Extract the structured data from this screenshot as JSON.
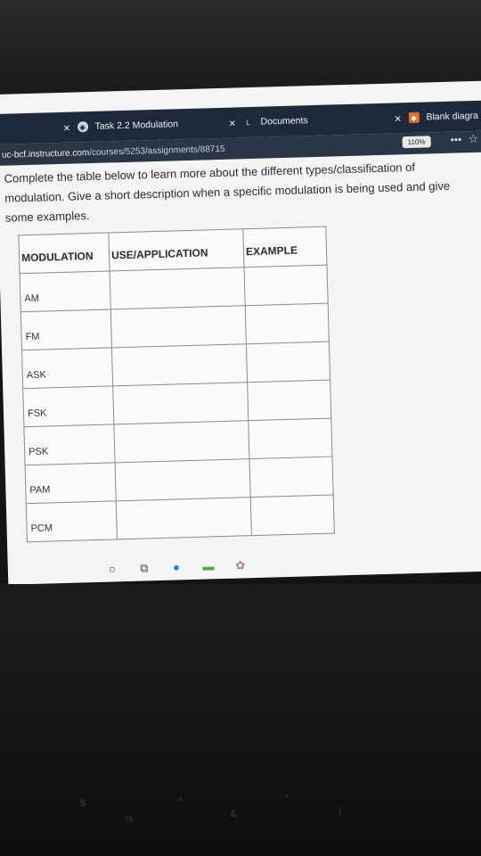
{
  "browser": {
    "tabs": [
      {
        "label": "Task 2.2 Modulation",
        "close": "×"
      },
      {
        "label": "Documents",
        "close": "×"
      },
      {
        "label": "Blank diagra",
        "close": "×"
      }
    ],
    "url_host": "uc-bcf.instructure.com",
    "url_path": "/courses/5253/assignments/88715",
    "zoom": "110%",
    "more": "•••",
    "star": "☆"
  },
  "assignment": {
    "instructions": "Complete the table below to learn more about the different types/classification of modulation. Give a short description when a specific modulation is being used and give some examples."
  },
  "table": {
    "headers": [
      "MODULATION",
      "USE/APPLICATION",
      "EXAMPLE"
    ],
    "rows": [
      {
        "modulation": "AM",
        "use": "",
        "example": ""
      },
      {
        "modulation": "FM",
        "use": "",
        "example": ""
      },
      {
        "modulation": "ASK",
        "use": "",
        "example": ""
      },
      {
        "modulation": "FSK",
        "use": "",
        "example": ""
      },
      {
        "modulation": "PSK",
        "use": "",
        "example": ""
      },
      {
        "modulation": "PAM",
        "use": "",
        "example": ""
      },
      {
        "modulation": "PCM",
        "use": "",
        "example": ""
      }
    ]
  },
  "taskbar": {
    "icons": [
      "search-icon",
      "task-view-icon",
      "edge-icon",
      "explorer-icon",
      "app-icon"
    ]
  },
  "colors": {
    "tabbar": "#1e2a3a",
    "page_bg": "#f4f4f2",
    "table_border": "#8a8a8a"
  }
}
